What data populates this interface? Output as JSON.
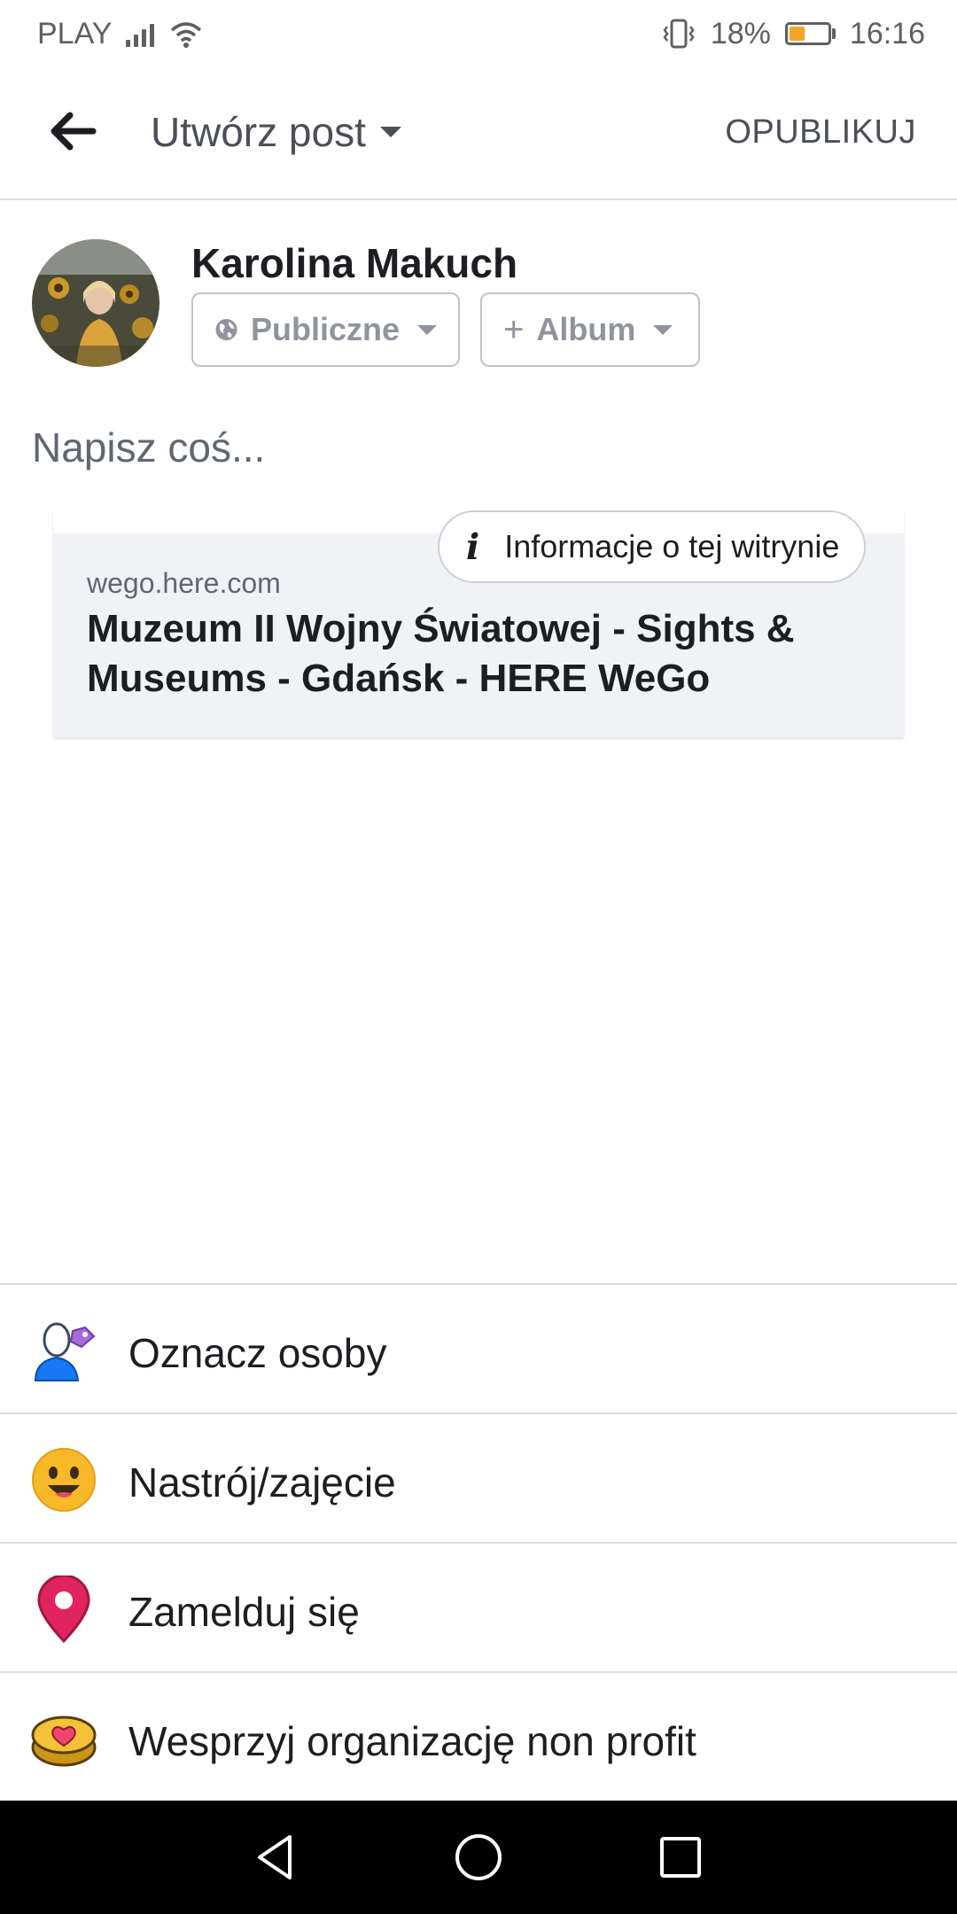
{
  "status_bar": {
    "carrier": "PLAY",
    "battery_percent": "18%",
    "time": "16:16",
    "icons": [
      "signal-icon",
      "wifi-icon",
      "vibrate-icon",
      "battery-saver-icon"
    ]
  },
  "app_bar": {
    "title": "Utwórz post",
    "publish_label": "OPUBLIKUJ"
  },
  "author": {
    "name": "Karolina Makuch",
    "privacy_label": "Publiczne",
    "album_label": "Album"
  },
  "composer": {
    "placeholder": "Napisz coś..."
  },
  "link_preview": {
    "site_info_label": "Informacje o tej witrynie",
    "domain": "wego.here.com",
    "title": "Muzeum II Wojny Światowej - Sights & Museums - Gdańsk - HERE WeGo"
  },
  "actions": [
    {
      "label": "Oznacz osoby",
      "icon": "tag-people-icon"
    },
    {
      "label": "Nastrój/zajęcie",
      "icon": "smiley-icon"
    },
    {
      "label": "Zamelduj się",
      "icon": "location-pin-icon"
    },
    {
      "label": "Wesprzyj organizację non profit",
      "icon": "charity-coin-icon"
    }
  ],
  "colors": {
    "battery_fill": "#f5a623",
    "pin_red": "#e0245e",
    "smiley_yellow": "#f7b928",
    "tag_blue": "#1877f2"
  }
}
